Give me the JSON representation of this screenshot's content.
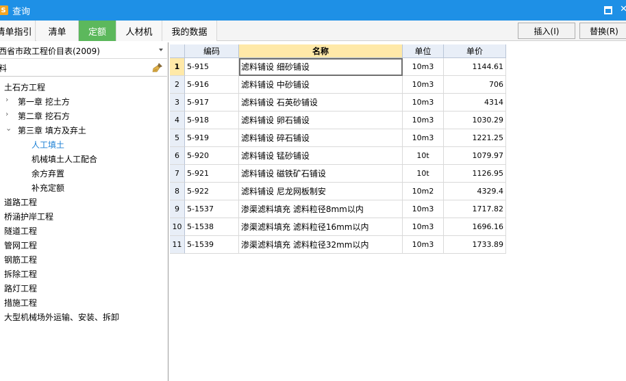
{
  "window": {
    "title": "查询",
    "icon_letter": "S"
  },
  "tabs": [
    {
      "label": "清单指引",
      "active": false
    },
    {
      "label": "清单",
      "active": false
    },
    {
      "label": "定额",
      "active": true
    },
    {
      "label": "人材机",
      "active": false
    },
    {
      "label": "我的数据",
      "active": false
    }
  ],
  "actions": {
    "insert": "插入(I)",
    "replace": "替换(R)"
  },
  "library": {
    "selected": "西省市政工程价目表(2009)"
  },
  "search": {
    "value": "料"
  },
  "tree": [
    {
      "label": "土石方工程",
      "level": 0,
      "chevron": ""
    },
    {
      "label": "第一章 挖土方",
      "level": 1,
      "chevron": "›"
    },
    {
      "label": "第二章 挖石方",
      "level": 1,
      "chevron": "›"
    },
    {
      "label": "第三章 填方及弃土",
      "level": 1,
      "chevron": "⌄"
    },
    {
      "label": "人工填土",
      "level": 2,
      "chevron": "",
      "selected": true
    },
    {
      "label": "机械填土人工配合",
      "level": 2,
      "chevron": ""
    },
    {
      "label": "余方弃置",
      "level": 2,
      "chevron": ""
    },
    {
      "label": "补充定额",
      "level": 2,
      "chevron": ""
    },
    {
      "label": "道路工程",
      "level": 0,
      "chevron": ""
    },
    {
      "label": "桥涵护岸工程",
      "level": 0,
      "chevron": ""
    },
    {
      "label": "隧道工程",
      "level": 0,
      "chevron": ""
    },
    {
      "label": "管网工程",
      "level": 0,
      "chevron": ""
    },
    {
      "label": "钢筋工程",
      "level": 0,
      "chevron": ""
    },
    {
      "label": "拆除工程",
      "level": 0,
      "chevron": ""
    },
    {
      "label": "路灯工程",
      "level": 0,
      "chevron": ""
    },
    {
      "label": "措施工程",
      "level": 0,
      "chevron": ""
    },
    {
      "label": "大型机械场外运输、安装、拆卸",
      "level": 0,
      "chevron": ""
    }
  ],
  "grid": {
    "headers": {
      "code": "编码",
      "name": "名称",
      "unit": "单位",
      "price": "单价"
    },
    "rows": [
      {
        "num": "1",
        "code": "5-915",
        "name": "滤料铺设 细砂铺设",
        "unit": "10m3",
        "price": "1144.61"
      },
      {
        "num": "2",
        "code": "5-916",
        "name": "滤料铺设 中砂铺设",
        "unit": "10m3",
        "price": "706"
      },
      {
        "num": "3",
        "code": "5-917",
        "name": "滤料铺设 石英砂铺设",
        "unit": "10m3",
        "price": "4314"
      },
      {
        "num": "4",
        "code": "5-918",
        "name": "滤料铺设 卵石铺设",
        "unit": "10m3",
        "price": "1030.29"
      },
      {
        "num": "5",
        "code": "5-919",
        "name": "滤料铺设 碎石铺设",
        "unit": "10m3",
        "price": "1221.25"
      },
      {
        "num": "6",
        "code": "5-920",
        "name": "滤料铺设 锰砂铺设",
        "unit": "10t",
        "price": "1079.97"
      },
      {
        "num": "7",
        "code": "5-921",
        "name": "滤料铺设 磁铁矿石铺设",
        "unit": "10t",
        "price": "1126.95"
      },
      {
        "num": "8",
        "code": "5-922",
        "name": "滤料铺设 尼龙网板制安",
        "unit": "10m2",
        "price": "4329.4"
      },
      {
        "num": "9",
        "code": "5-1537",
        "name": "渗渠滤料填充 滤料粒径8mm以内",
        "unit": "10m3",
        "price": "1717.82"
      },
      {
        "num": "10",
        "code": "5-1538",
        "name": "渗渠滤料填充 滤料粒径16mm以内",
        "unit": "10m3",
        "price": "1696.16"
      },
      {
        "num": "11",
        "code": "5-1539",
        "name": "渗渠滤料填充 滤料粒径32mm以内",
        "unit": "10m3",
        "price": "1733.89"
      }
    ]
  },
  "colors": {
    "titlebar": "#1e90e6",
    "active_tab": "#5cb85c",
    "selected_tree": "#1a7fd4"
  }
}
